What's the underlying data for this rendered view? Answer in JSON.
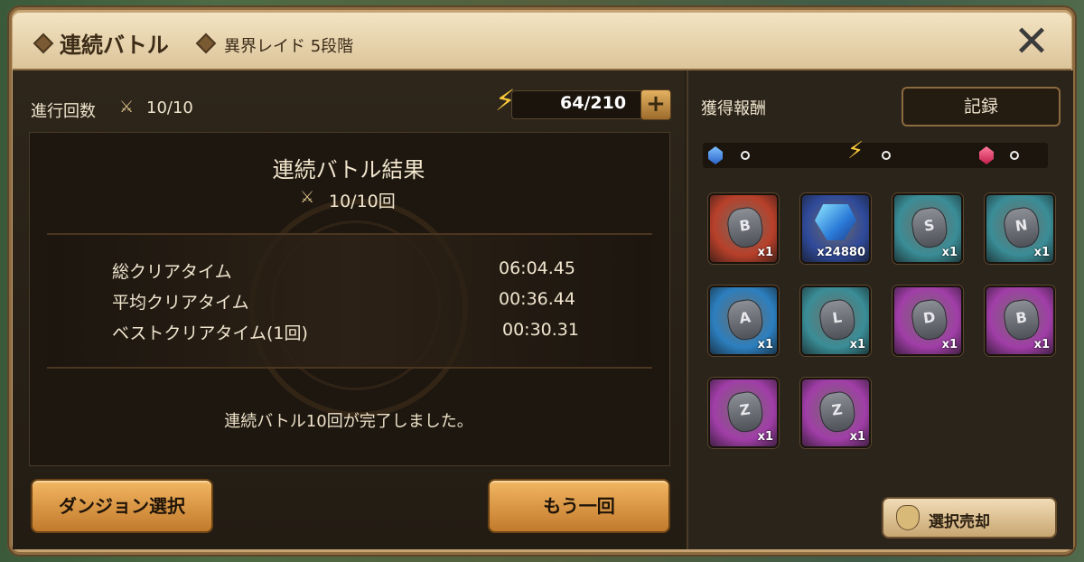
{
  "header": {
    "title": "連続バトル",
    "subtitle": "異界レイド 5段階",
    "close_icon": "close-x-icon"
  },
  "progress": {
    "label": "進行回数",
    "count": "10/10"
  },
  "energy": {
    "value": "64/210",
    "plus": "+"
  },
  "result": {
    "title": "連続バトル結果",
    "count": "10/10回",
    "times": [
      {
        "label": "総クリアタイム",
        "value": "06:04.45"
      },
      {
        "label": "平均クリアタイム",
        "value": "00:36.44"
      },
      {
        "label": "ベストクリアタイム(1回)",
        "value": "00:30.31"
      }
    ],
    "message": "連続バトル10回が完了しました。"
  },
  "buttons": {
    "dungeon_select": "ダンジョン選択",
    "retry": "もう一回"
  },
  "rewards": {
    "label": "獲得報酬",
    "record": "記録",
    "sell": "選択売却",
    "tiles": [
      {
        "glyph": "B",
        "qty": "x1",
        "bg": "red"
      },
      {
        "glyph": "",
        "qty": "x24880",
        "bg": "crystal"
      },
      {
        "glyph": "S",
        "qty": "x1",
        "bg": "teal"
      },
      {
        "glyph": "N",
        "qty": "x1",
        "bg": "teal"
      },
      {
        "glyph": "A",
        "qty": "x1",
        "bg": "blue"
      },
      {
        "glyph": "L",
        "qty": "x1",
        "bg": "teal"
      },
      {
        "glyph": "D",
        "qty": "x1",
        "bg": "purple"
      },
      {
        "glyph": "B",
        "qty": "x1",
        "bg": "purple"
      },
      {
        "glyph": "Z",
        "qty": "x1",
        "bg": "purple"
      },
      {
        "glyph": "Z",
        "qty": "x1",
        "bg": "purple"
      }
    ]
  },
  "colors": {
    "red": "#b8402a",
    "teal": "#3a8d97",
    "blue": "#2c7fbf",
    "purple": "#a13ea8",
    "crystal": "#2f4a9a"
  }
}
